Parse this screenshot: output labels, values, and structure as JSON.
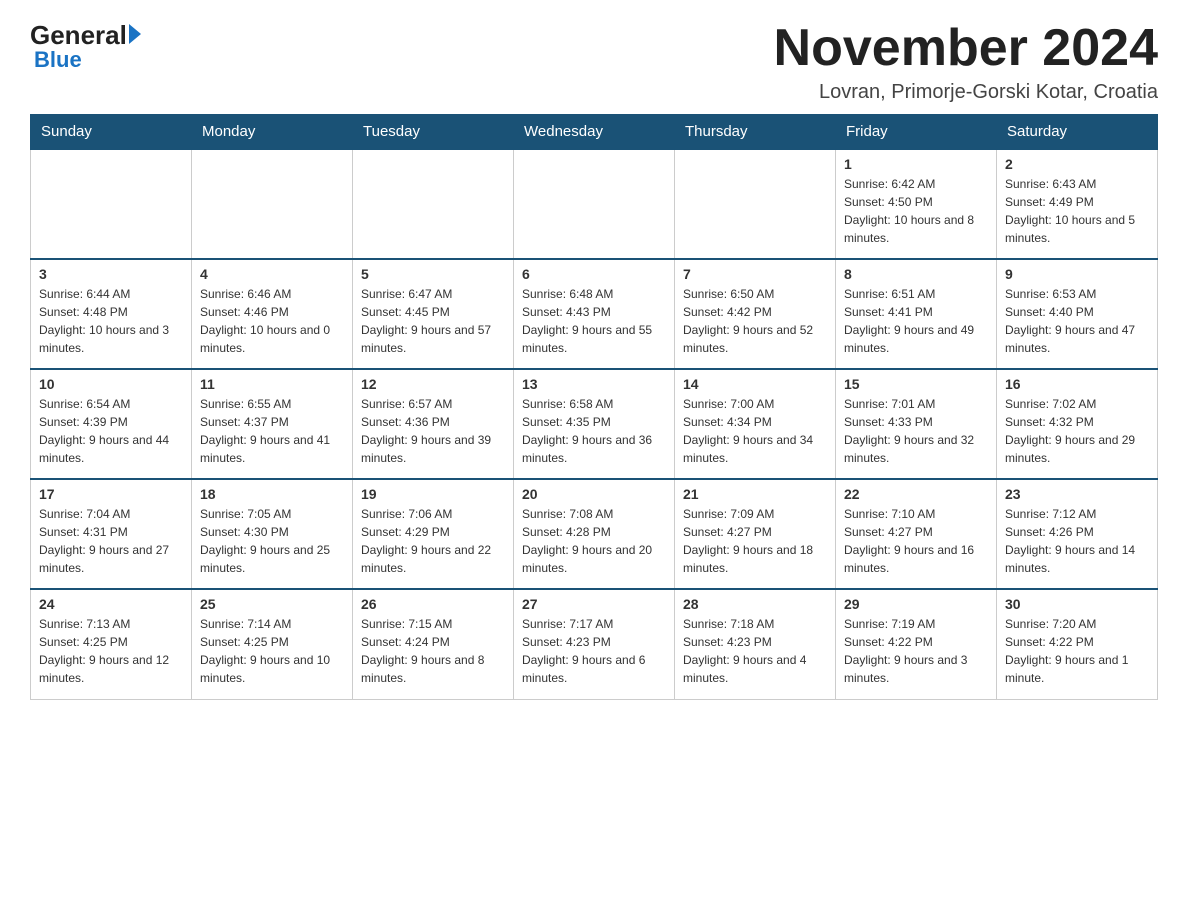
{
  "header": {
    "logo_general": "General",
    "logo_blue": "Blue",
    "month_title": "November 2024",
    "subtitle": "Lovran, Primorje-Gorski Kotar, Croatia"
  },
  "days_of_week": [
    "Sunday",
    "Monday",
    "Tuesday",
    "Wednesday",
    "Thursday",
    "Friday",
    "Saturday"
  ],
  "weeks": [
    {
      "days": [
        {
          "number": "",
          "info": ""
        },
        {
          "number": "",
          "info": ""
        },
        {
          "number": "",
          "info": ""
        },
        {
          "number": "",
          "info": ""
        },
        {
          "number": "",
          "info": ""
        },
        {
          "number": "1",
          "info": "Sunrise: 6:42 AM\nSunset: 4:50 PM\nDaylight: 10 hours and 8 minutes."
        },
        {
          "number": "2",
          "info": "Sunrise: 6:43 AM\nSunset: 4:49 PM\nDaylight: 10 hours and 5 minutes."
        }
      ]
    },
    {
      "days": [
        {
          "number": "3",
          "info": "Sunrise: 6:44 AM\nSunset: 4:48 PM\nDaylight: 10 hours and 3 minutes."
        },
        {
          "number": "4",
          "info": "Sunrise: 6:46 AM\nSunset: 4:46 PM\nDaylight: 10 hours and 0 minutes."
        },
        {
          "number": "5",
          "info": "Sunrise: 6:47 AM\nSunset: 4:45 PM\nDaylight: 9 hours and 57 minutes."
        },
        {
          "number": "6",
          "info": "Sunrise: 6:48 AM\nSunset: 4:43 PM\nDaylight: 9 hours and 55 minutes."
        },
        {
          "number": "7",
          "info": "Sunrise: 6:50 AM\nSunset: 4:42 PM\nDaylight: 9 hours and 52 minutes."
        },
        {
          "number": "8",
          "info": "Sunrise: 6:51 AM\nSunset: 4:41 PM\nDaylight: 9 hours and 49 minutes."
        },
        {
          "number": "9",
          "info": "Sunrise: 6:53 AM\nSunset: 4:40 PM\nDaylight: 9 hours and 47 minutes."
        }
      ]
    },
    {
      "days": [
        {
          "number": "10",
          "info": "Sunrise: 6:54 AM\nSunset: 4:39 PM\nDaylight: 9 hours and 44 minutes."
        },
        {
          "number": "11",
          "info": "Sunrise: 6:55 AM\nSunset: 4:37 PM\nDaylight: 9 hours and 41 minutes."
        },
        {
          "number": "12",
          "info": "Sunrise: 6:57 AM\nSunset: 4:36 PM\nDaylight: 9 hours and 39 minutes."
        },
        {
          "number": "13",
          "info": "Sunrise: 6:58 AM\nSunset: 4:35 PM\nDaylight: 9 hours and 36 minutes."
        },
        {
          "number": "14",
          "info": "Sunrise: 7:00 AM\nSunset: 4:34 PM\nDaylight: 9 hours and 34 minutes."
        },
        {
          "number": "15",
          "info": "Sunrise: 7:01 AM\nSunset: 4:33 PM\nDaylight: 9 hours and 32 minutes."
        },
        {
          "number": "16",
          "info": "Sunrise: 7:02 AM\nSunset: 4:32 PM\nDaylight: 9 hours and 29 minutes."
        }
      ]
    },
    {
      "days": [
        {
          "number": "17",
          "info": "Sunrise: 7:04 AM\nSunset: 4:31 PM\nDaylight: 9 hours and 27 minutes."
        },
        {
          "number": "18",
          "info": "Sunrise: 7:05 AM\nSunset: 4:30 PM\nDaylight: 9 hours and 25 minutes."
        },
        {
          "number": "19",
          "info": "Sunrise: 7:06 AM\nSunset: 4:29 PM\nDaylight: 9 hours and 22 minutes."
        },
        {
          "number": "20",
          "info": "Sunrise: 7:08 AM\nSunset: 4:28 PM\nDaylight: 9 hours and 20 minutes."
        },
        {
          "number": "21",
          "info": "Sunrise: 7:09 AM\nSunset: 4:27 PM\nDaylight: 9 hours and 18 minutes."
        },
        {
          "number": "22",
          "info": "Sunrise: 7:10 AM\nSunset: 4:27 PM\nDaylight: 9 hours and 16 minutes."
        },
        {
          "number": "23",
          "info": "Sunrise: 7:12 AM\nSunset: 4:26 PM\nDaylight: 9 hours and 14 minutes."
        }
      ]
    },
    {
      "days": [
        {
          "number": "24",
          "info": "Sunrise: 7:13 AM\nSunset: 4:25 PM\nDaylight: 9 hours and 12 minutes."
        },
        {
          "number": "25",
          "info": "Sunrise: 7:14 AM\nSunset: 4:25 PM\nDaylight: 9 hours and 10 minutes."
        },
        {
          "number": "26",
          "info": "Sunrise: 7:15 AM\nSunset: 4:24 PM\nDaylight: 9 hours and 8 minutes."
        },
        {
          "number": "27",
          "info": "Sunrise: 7:17 AM\nSunset: 4:23 PM\nDaylight: 9 hours and 6 minutes."
        },
        {
          "number": "28",
          "info": "Sunrise: 7:18 AM\nSunset: 4:23 PM\nDaylight: 9 hours and 4 minutes."
        },
        {
          "number": "29",
          "info": "Sunrise: 7:19 AM\nSunset: 4:22 PM\nDaylight: 9 hours and 3 minutes."
        },
        {
          "number": "30",
          "info": "Sunrise: 7:20 AM\nSunset: 4:22 PM\nDaylight: 9 hours and 1 minute."
        }
      ]
    }
  ]
}
